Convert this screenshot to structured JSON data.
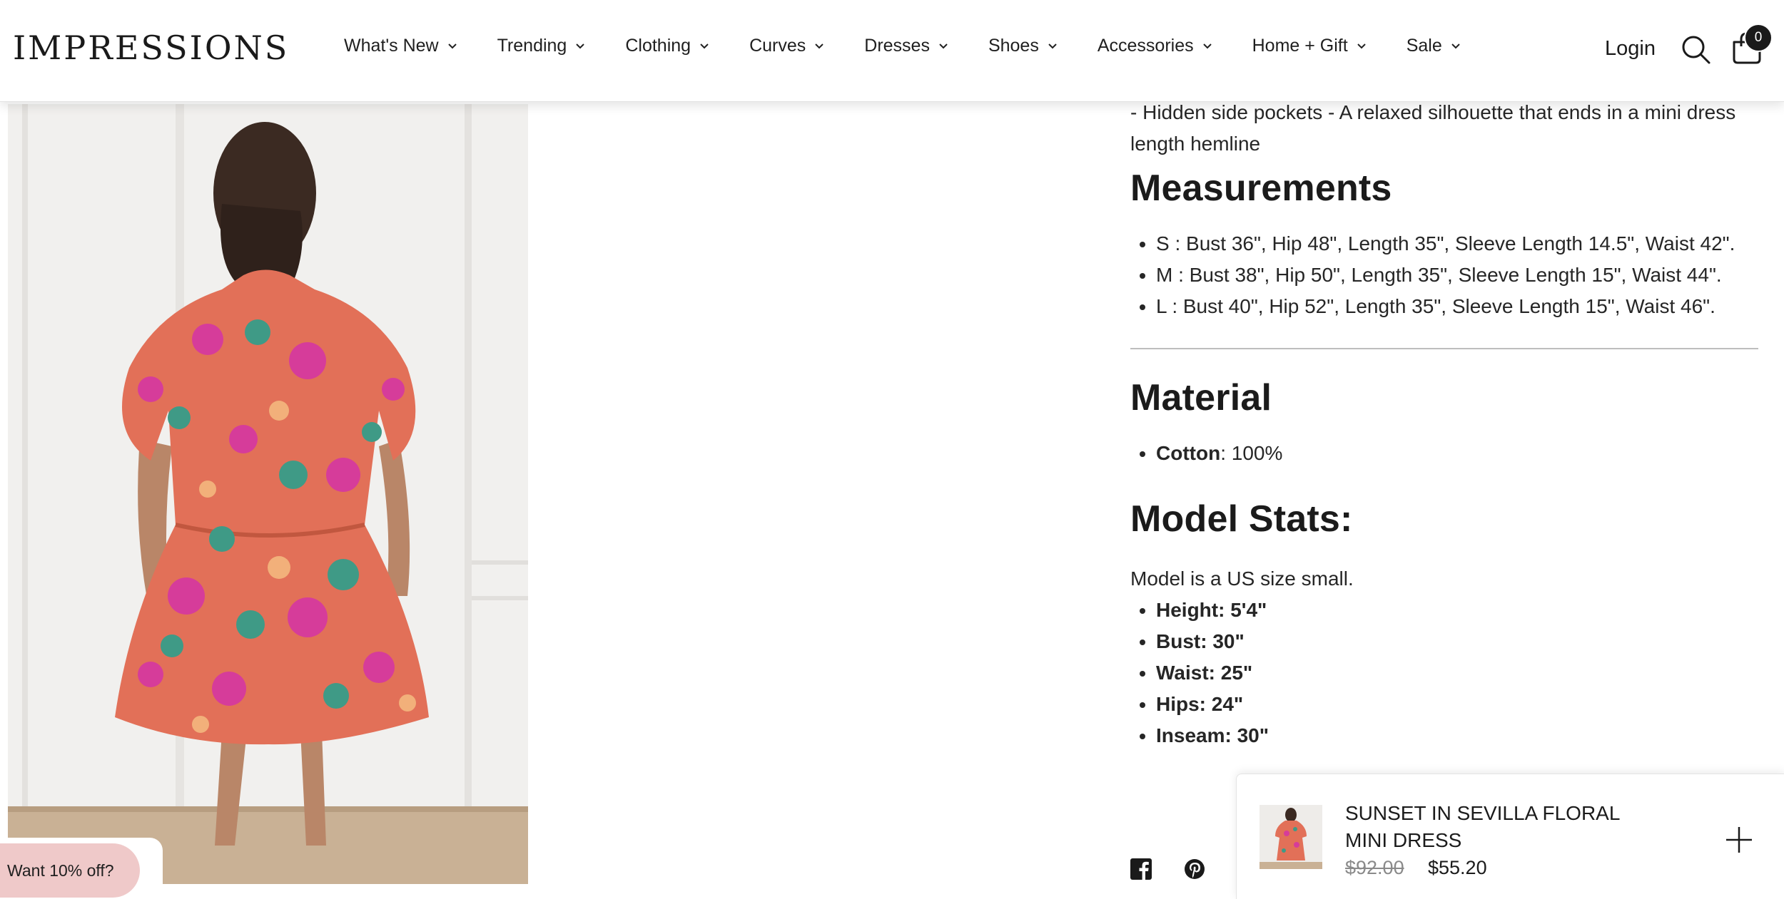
{
  "header": {
    "logo": "IMPRESSIONS",
    "nav": [
      "What's New",
      "Trending",
      "Clothing",
      "Curves",
      "Dresses",
      "Shoes",
      "Accessories",
      "Home + Gift",
      "Sale"
    ],
    "login": "Login",
    "cart_count": "0"
  },
  "description": {
    "intro": "- Hidden side pockets - A relaxed silhouette that ends in a mini dress length hemline",
    "measurements_title": "Measurements",
    "measurements": [
      "S : Bust 36\", Hip 48\", Length 35\", Sleeve Length 14.5\", Waist 42\".",
      "M : Bust 38\", Hip 50\", Length 35\", Sleeve Length 15\", Waist 44\".",
      "L : Bust 40\", Hip 52\", Length 35\", Sleeve Length 15\", Waist 46\"."
    ],
    "material_title": "Material",
    "material_label": "Cotton",
    "material_value": ": 100%",
    "model_title": "Model Stats:",
    "model_intro": "Model is a US size small.",
    "model_stats": [
      "Height: 5'4\"",
      "Bust: 30\"",
      "Waist: 25\"",
      "Hips: 24\"",
      "Inseam: 30\""
    ]
  },
  "promo": {
    "label": "Want 10% off?"
  },
  "sticky_cart": {
    "title": "SUNSET IN SEVILLA FLORAL MINI DRESS",
    "old_price": "$92.00",
    "new_price": "$55.20"
  },
  "colors": {
    "promo_bg": "#efc9c9",
    "text": "#1f1f1f",
    "badge": "#1a1a1a"
  },
  "icons": [
    "search-icon",
    "cart-icon",
    "chevron-down-icon",
    "facebook-icon",
    "pinterest-icon",
    "plus-icon"
  ]
}
